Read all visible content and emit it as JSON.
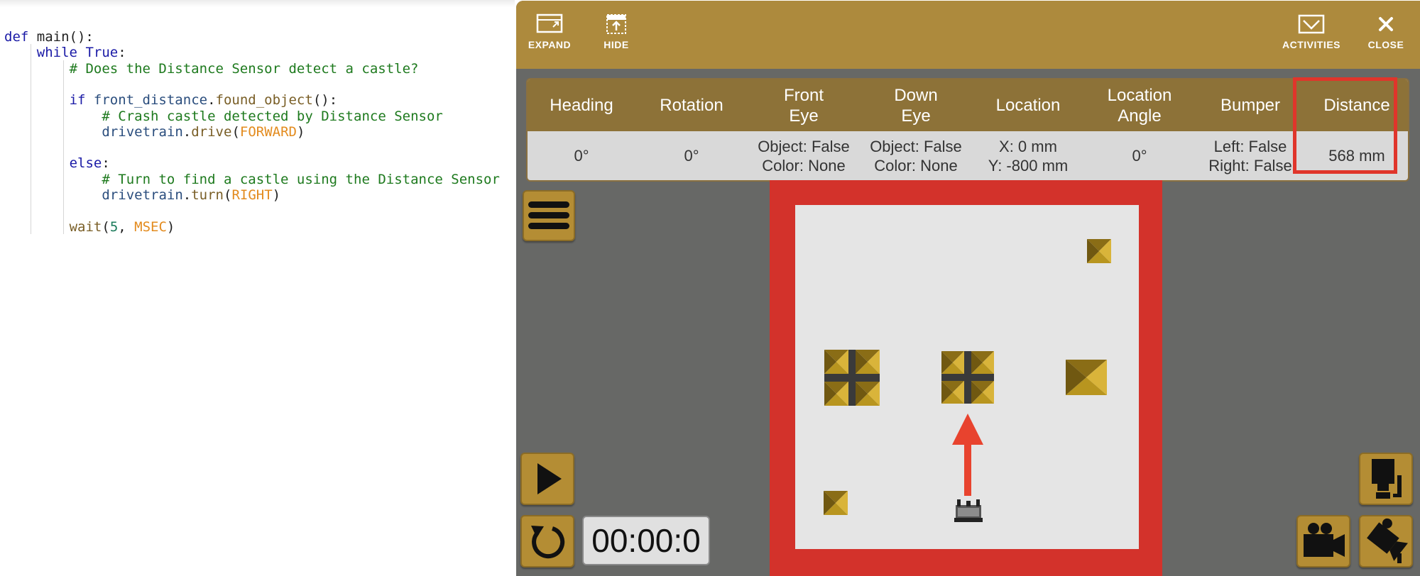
{
  "editor": {
    "lines": [
      [
        {
          "t": "def ",
          "c": "kw"
        },
        {
          "t": "main():",
          "c": "plain"
        }
      ],
      [
        {
          "t": "while ",
          "c": "kw"
        },
        {
          "t": "True",
          "c": "kw"
        },
        {
          "t": ":",
          "c": "plain"
        }
      ],
      [
        {
          "t": "# Does the Distance Sensor detect a castle?",
          "c": "cm"
        }
      ],
      [],
      [
        {
          "t": "if ",
          "c": "kw"
        },
        {
          "t": "front_distance",
          "c": "var"
        },
        {
          "t": ".",
          "c": "plain"
        },
        {
          "t": "found_object",
          "c": "fn"
        },
        {
          "t": "():",
          "c": "plain"
        }
      ],
      [
        {
          "t": "# Crash castle detected by Distance Sensor",
          "c": "cm"
        }
      ],
      [
        {
          "t": "drivetrain",
          "c": "var"
        },
        {
          "t": ".",
          "c": "plain"
        },
        {
          "t": "drive",
          "c": "fn"
        },
        {
          "t": "(",
          "c": "plain"
        },
        {
          "t": "FORWARD",
          "c": "const"
        },
        {
          "t": ")",
          "c": "plain"
        }
      ],
      [],
      [
        {
          "t": "else",
          "c": "kw"
        },
        {
          "t": ":",
          "c": "plain"
        }
      ],
      [
        {
          "t": "# Turn to find a castle using the Distance Sensor",
          "c": "cm"
        }
      ],
      [
        {
          "t": "drivetrain",
          "c": "var"
        },
        {
          "t": ".",
          "c": "plain"
        },
        {
          "t": "turn",
          "c": "fn"
        },
        {
          "t": "(",
          "c": "plain"
        },
        {
          "t": "RIGHT",
          "c": "const"
        },
        {
          "t": ")",
          "c": "plain"
        }
      ],
      [],
      [
        {
          "t": "wait",
          "c": "fn"
        },
        {
          "t": "(",
          "c": "plain"
        },
        {
          "t": "5",
          "c": "num"
        },
        {
          "t": ", ",
          "c": "plain"
        },
        {
          "t": "MSEC",
          "c": "const"
        },
        {
          "t": ")",
          "c": "plain"
        }
      ]
    ]
  },
  "toolbar": {
    "expand": "EXPAND",
    "hide": "HIDE",
    "activities": "ACTIVITIES",
    "close": "CLOSE"
  },
  "sensors": {
    "headers": [
      "Heading",
      "Rotation",
      "Front\nEye",
      "Down\nEye",
      "Location",
      "Location\nAngle",
      "Bumper",
      "Distance"
    ],
    "values": [
      "0°",
      "0°",
      "Object: False\nColor: None",
      "Object: False\nColor: None",
      "X: 0 mm\nY: -800 mm",
      "0°",
      "Left: False\nRight: False",
      "568 mm"
    ]
  },
  "timer": "00:00:0",
  "colors": {
    "toolbar": "#ad8a3d",
    "table_header": "#8d7238",
    "arena_wall": "#d3322b",
    "highlight": "#e0352b",
    "panel_bg": "#676866"
  },
  "icons": {
    "menu": "hamburger-icon",
    "play": "play-icon",
    "reset": "reset-icon",
    "camera_top": "top-camera-icon",
    "camera_side": "side-camera-icon",
    "camera_follow": "follow-camera-icon"
  }
}
